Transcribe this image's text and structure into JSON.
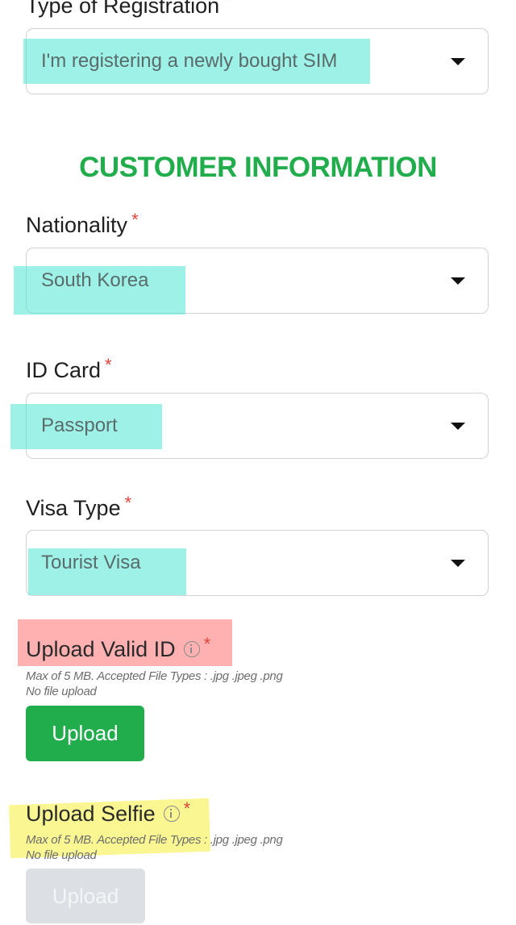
{
  "registration": {
    "label": "Type of Registration",
    "required_mark": "*",
    "value": "I'm registering a newly bought SIM"
  },
  "section_title": "CUSTOMER INFORMATION",
  "fields": {
    "nationality": {
      "label": "Nationality",
      "required_mark": "*",
      "value": "South Korea"
    },
    "id_card": {
      "label": "ID Card",
      "required_mark": "*",
      "value": "Passport"
    },
    "visa_type": {
      "label": "Visa Type",
      "required_mark": "*",
      "value": "Tourist Visa"
    }
  },
  "uploads": {
    "valid_id": {
      "label": "Upload Valid ID",
      "required_mark": "*",
      "hint": "Max of 5 MB. Accepted File Types : .jpg .jpeg .png",
      "status": "No file upload",
      "button_label": "Upload"
    },
    "selfie": {
      "label": "Upload Selfie",
      "required_mark": "*",
      "hint": "Max of 5 MB. Accepted File Types : .jpg .jpeg .png",
      "status": "No file upload",
      "button_label": "Upload"
    }
  },
  "icons": {
    "dropdown": "chevron-down-icon",
    "info": "info-icon"
  },
  "colors": {
    "accent_green": "#22ad4d",
    "required_red": "#e0443a",
    "highlight_cyan": "#4fe6d2",
    "highlight_red": "#ff6f6f",
    "highlight_yellow": "#f5f03a",
    "disabled_button": "#dcdfe4"
  }
}
